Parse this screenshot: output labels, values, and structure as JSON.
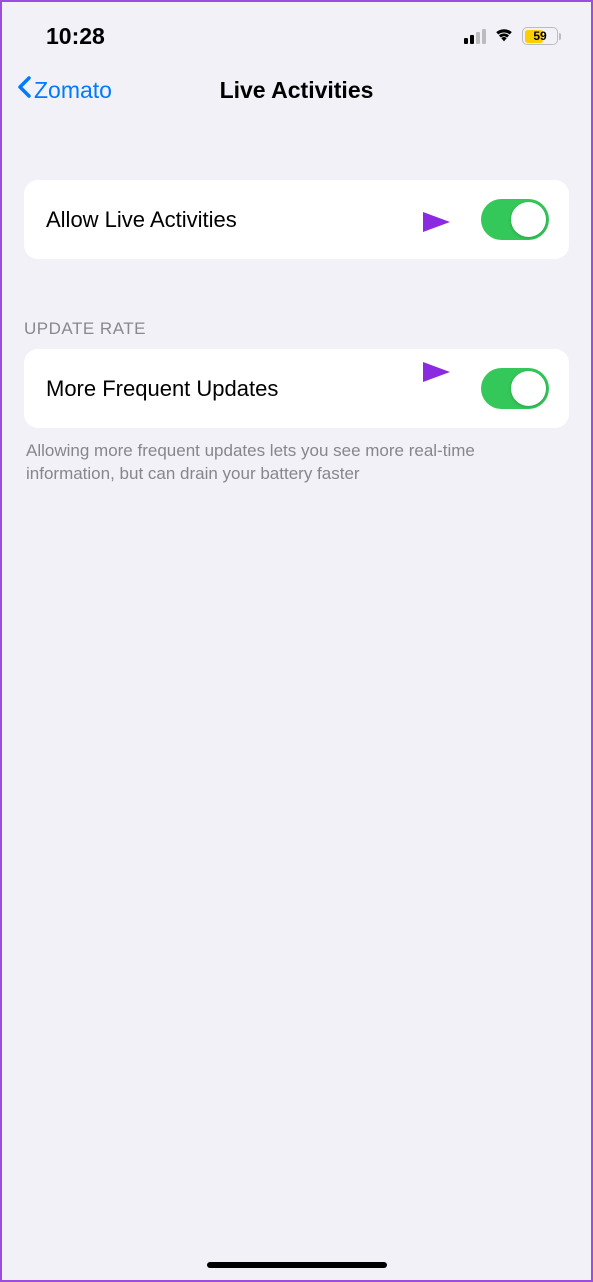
{
  "status": {
    "time": "10:28",
    "battery_level": "59"
  },
  "nav": {
    "back_label": "Zomato",
    "title": "Live Activities"
  },
  "settings": {
    "allow_label": "Allow Live Activities"
  },
  "update_rate": {
    "header": "UPDATE RATE",
    "row_label": "More Frequent Updates",
    "footer": "Allowing more frequent updates lets you see more real-time information, but can drain your battery faster"
  }
}
